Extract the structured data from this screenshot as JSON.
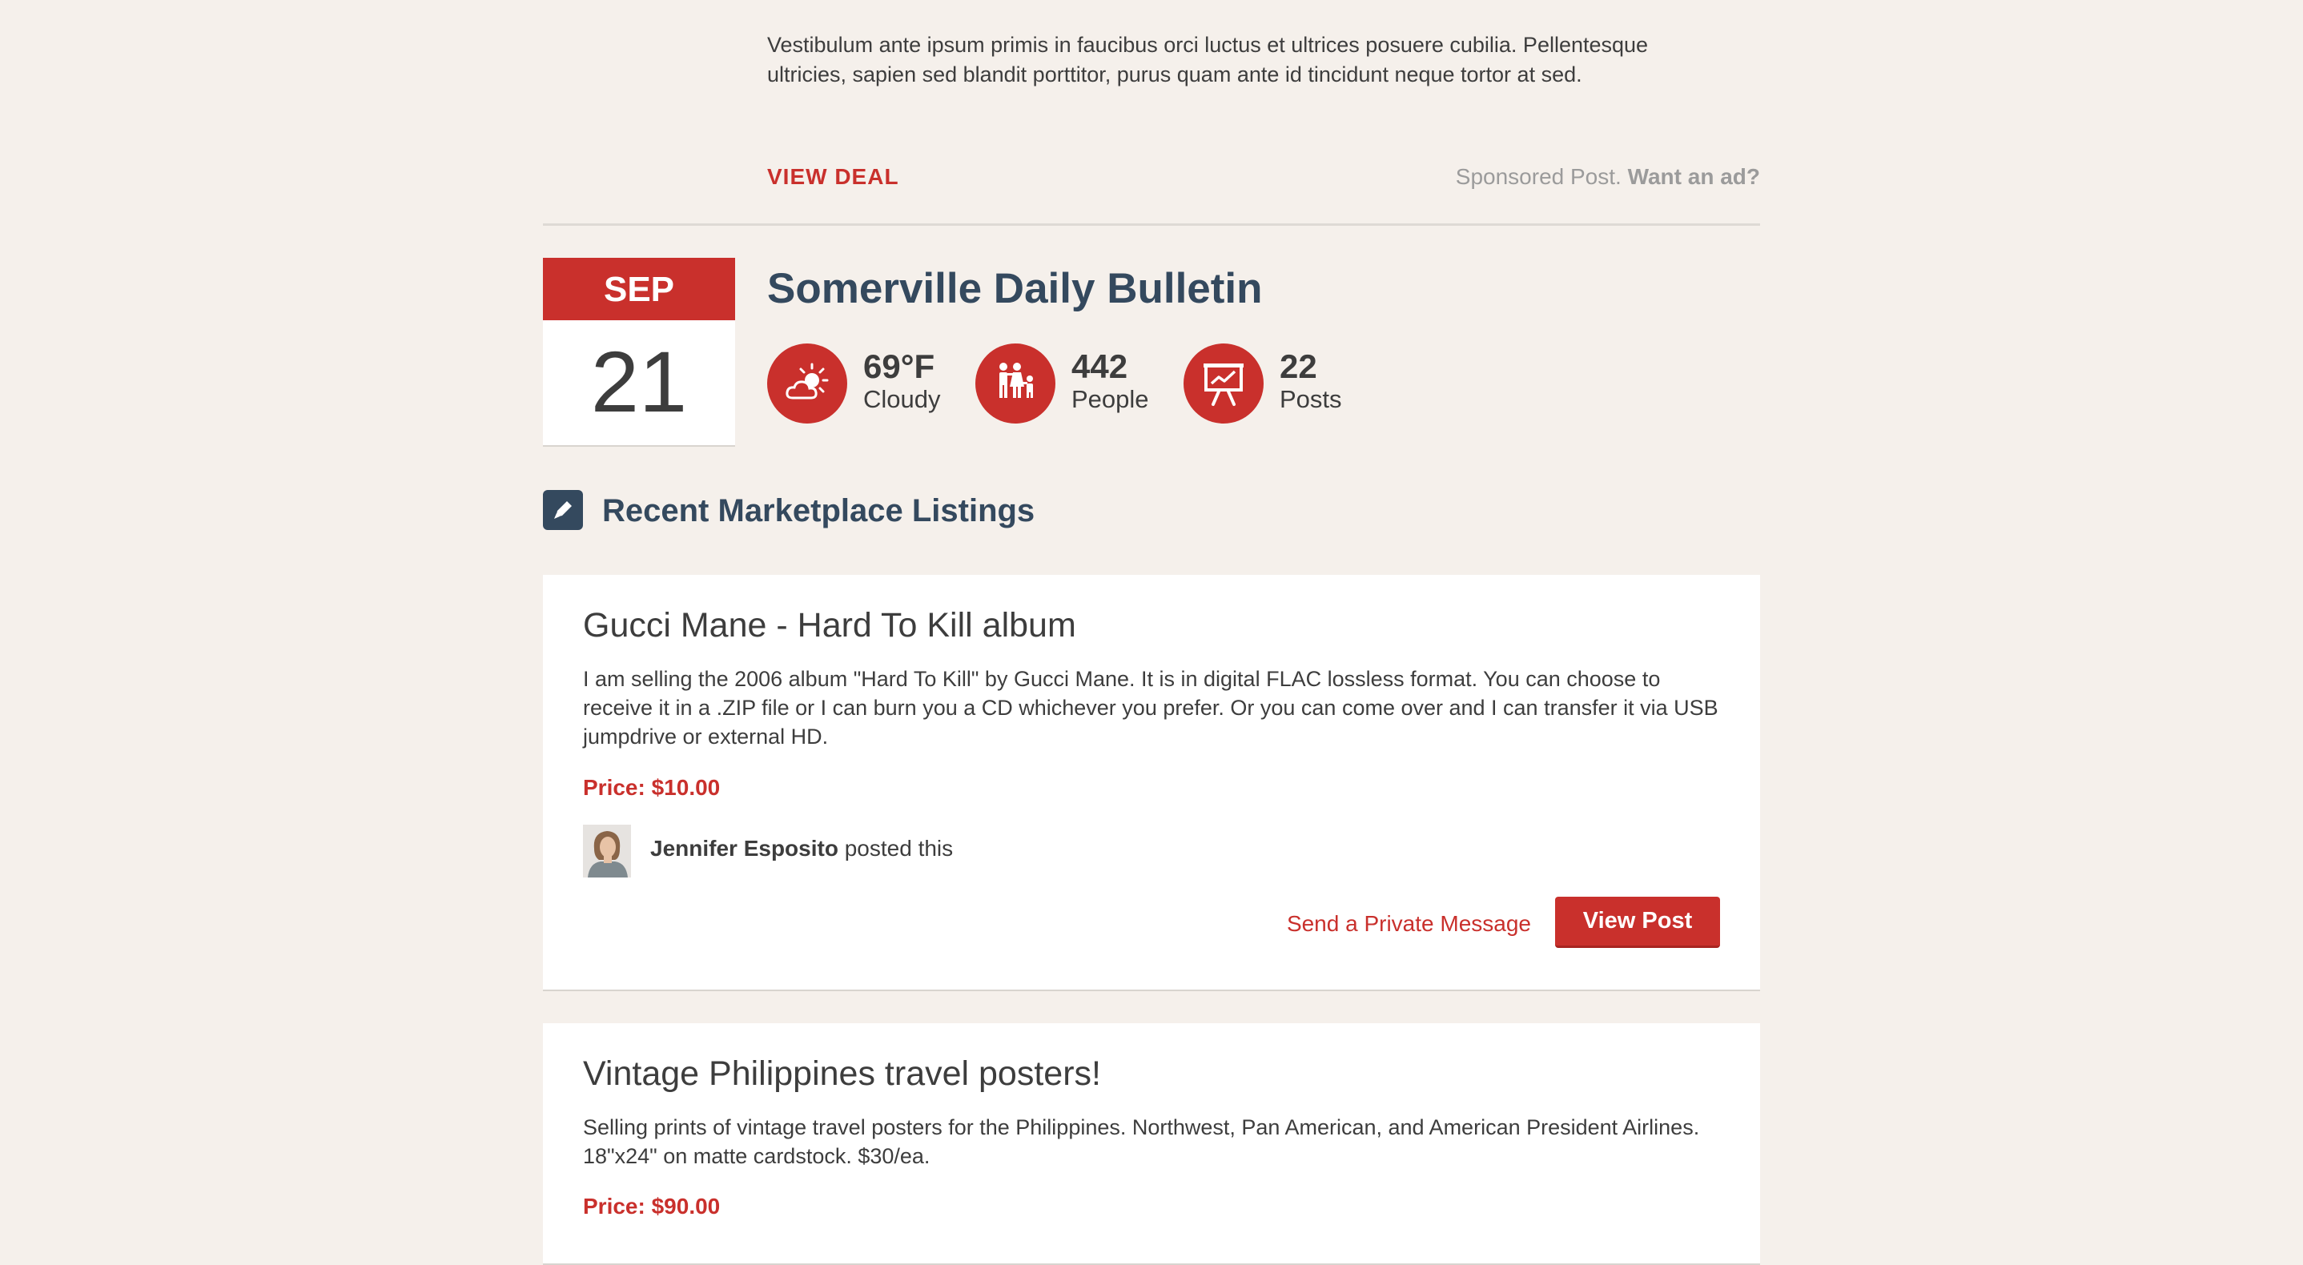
{
  "ad": {
    "text": "Vestibulum ante ipsum primis in faucibus orci luctus et ultrices posuere cubilia. Pellentesque ultricies, sapien sed blandit porttitor, purus quam ante id tincidunt neque tortor at sed.",
    "cta_label": "VIEW DEAL",
    "sponsored_label": "Sponsored Post.",
    "want_ad_label": "Want an ad?"
  },
  "date": {
    "month": "SEP",
    "day": "21"
  },
  "bulletin": {
    "title": "Somerville Daily Bulletin",
    "stats": [
      {
        "icon": "weather-icon",
        "value": "69°F",
        "label": "Cloudy"
      },
      {
        "icon": "people-icon",
        "value": "442",
        "label": "People"
      },
      {
        "icon": "presentation-icon",
        "value": "22",
        "label": "Posts"
      }
    ]
  },
  "section": {
    "title": "Recent Marketplace Listings",
    "icon": "tag-pencil-icon"
  },
  "listings": [
    {
      "title": "Gucci Mane - Hard To Kill album",
      "description": "I am selling the 2006 album \"Hard To Kill\" by Gucci Mane. It is in digital FLAC lossless format. You can choose to receive it in a .ZIP file or I can burn you a CD whichever you prefer. Or you can come over and I can transfer it via USB jumpdrive or external HD.",
      "price": "Price: $10.00",
      "poster_name": "Jennifer Esposito",
      "poster_suffix": " posted this",
      "message_label": "Send a Private Message",
      "view_label": "View Post"
    },
    {
      "title": "Vintage Philippines travel posters!",
      "description": "Selling prints of vintage travel posters for the Philippines. Northwest, Pan American, and American President Airlines. 18\"x24\" on matte cardstock. $30/ea.",
      "price": "Price: $90.00"
    }
  ],
  "colors": {
    "accent": "#c9302c",
    "heading": "#34495e",
    "background": "#f5f0eb"
  }
}
